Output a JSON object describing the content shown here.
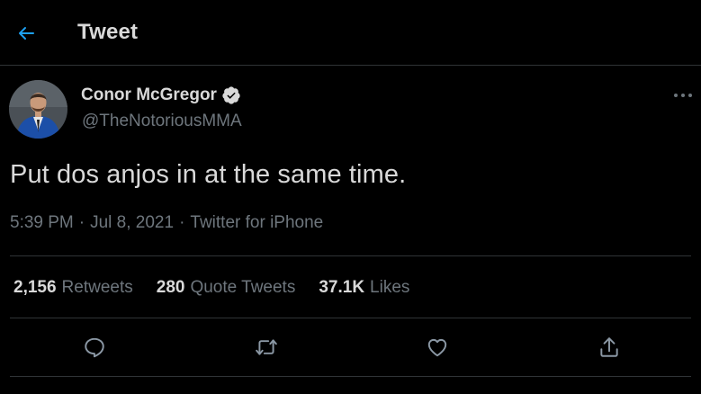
{
  "header": {
    "back_icon": "arrow-left-icon",
    "title": "Tweet"
  },
  "author": {
    "name": "Conor McGregor",
    "handle": "@TheNotoriousMMA",
    "verified_icon": "verified-badge-icon"
  },
  "tweet": {
    "text": "Put dos anjos in at the same time.",
    "time": "5:39 PM",
    "date": "Jul 8, 2021",
    "source": "Twitter for iPhone",
    "separator": "·"
  },
  "stats": {
    "retweets": {
      "count": "2,156",
      "label": "Retweets"
    },
    "quotes": {
      "count": "280",
      "label": "Quote Tweets"
    },
    "likes": {
      "count": "37.1K",
      "label": "Likes"
    }
  },
  "actions": {
    "reply_icon": "reply-icon",
    "retweet_icon": "retweet-icon",
    "like_icon": "heart-icon",
    "share_icon": "share-icon"
  },
  "colors": {
    "background": "#000000",
    "text": "#d9d9d9",
    "secondary": "#6e767d",
    "accent": "#1da1f2",
    "border": "#2f3336"
  }
}
